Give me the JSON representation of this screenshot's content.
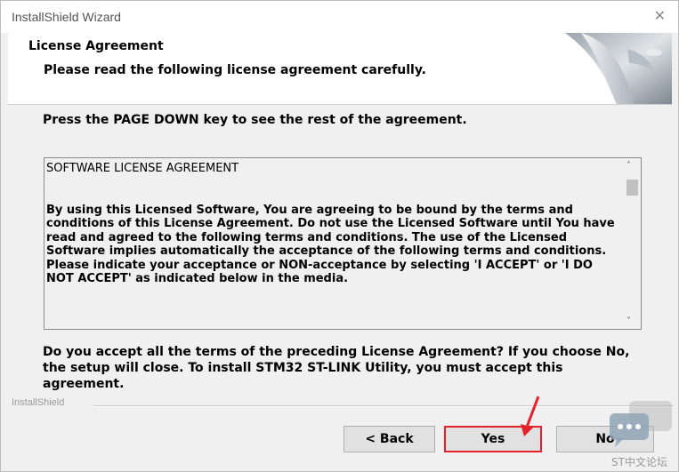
{
  "window": {
    "title": "InstallShield Wizard",
    "close_glyph": "✕"
  },
  "header": {
    "title": "License Agreement",
    "subtitle": "Please read the following license agreement carefully."
  },
  "instruction": "Press the PAGE DOWN key to see the rest of the agreement.",
  "license": {
    "heading": "SOFTWARE LICENSE AGREEMENT",
    "body": "By using this Licensed Software, You are agreeing to be bound by the terms and conditions of this License Agreement. Do not use the Licensed Software until You have read and agreed to the following terms and conditions. The use of the Licensed Software implies automatically the acceptance of the following terms and conditions. Please indicate your acceptance or NON-acceptance by selecting 'I ACCEPT' or 'I DO NOT ACCEPT' as indicated below in the media.",
    "scroll_up_glyph": "˄",
    "scroll_down_glyph": "˅"
  },
  "question": "Do you accept all the terms of the preceding License Agreement?  If you choose No,  the setup will close.  To install STM32 ST-LINK Utility, you must accept this agreement.",
  "brand": "InstallShield",
  "buttons": {
    "back": "< Back",
    "yes": "Yes",
    "no": "No"
  },
  "watermark": {
    "text": "ST中文论坛"
  },
  "colors": {
    "highlight": "#e5212b",
    "background": "#f0f0f0",
    "header_bg": "#ffffff"
  },
  "icons": {
    "header_graphic": "installshield-corner-graphic",
    "annotation_arrow": "red-arrow-icon",
    "watermark": "chat-bubble-icon"
  }
}
